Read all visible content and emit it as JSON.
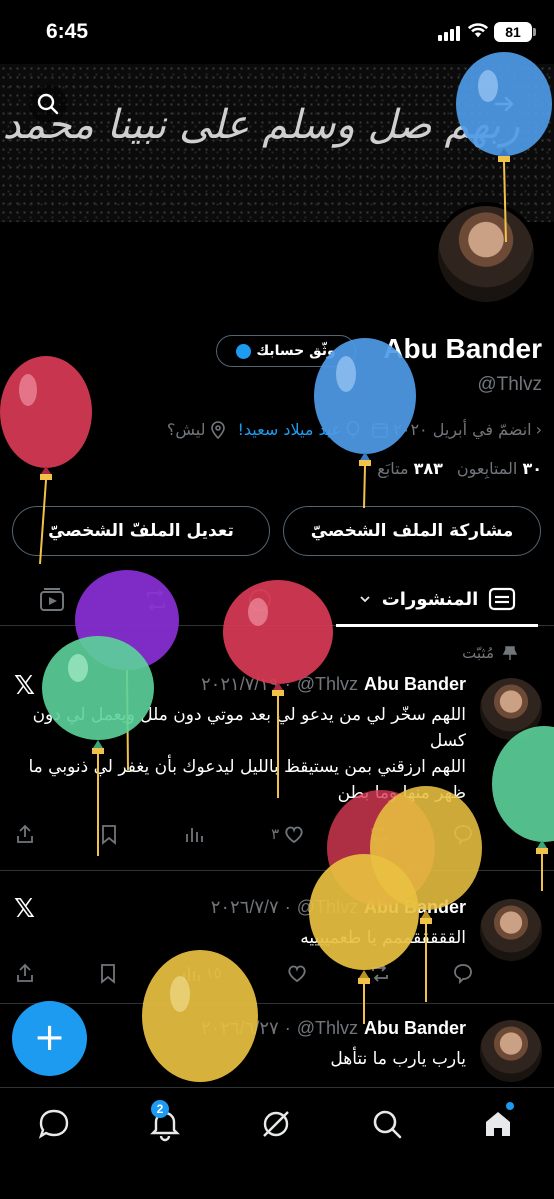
{
  "status_bar": {
    "time": "6:45",
    "battery": "81"
  },
  "banner": {
    "text": "ربهم صل وسلم على نبينا محمد"
  },
  "profile": {
    "verify_label": "وثّق حسابك",
    "display_name": "Abu Bander",
    "handle": "@Thlvz",
    "location": "ليش؟",
    "birthday": "عيد ميلاد سعيد!",
    "joined": "انضمّ في أبريل ٢٠٢٠",
    "following_count": "٣٨٣",
    "following_label": "متابَع",
    "followers_count": "٣٠",
    "followers_label": "المتابِعون",
    "share_label": "مشاركة الملف الشخصيّ",
    "edit_label": "تعديل الملفّ الشخصيّ"
  },
  "tabs": {
    "posts_label": "المنشورات"
  },
  "pinned_label": "مُثبّت",
  "tweets": [
    {
      "name": "Abu Bander",
      "handle": "@Thlvz",
      "date": "٢٠٢١/٧/١٩",
      "body": "اللهم سخّر لي من يدعو لي بعد موتي دون ملل ويعمل لي دون كسل\nاللهم ارزقني بمن يستيقظ بالليل ليدعوك بأن يغفر لي ذنوبي ما ظهر منها وما بطن",
      "likes": "٣",
      "views": ""
    },
    {
      "name": "Abu Bander",
      "handle": "@Thlvz",
      "date": "٢٠٢٦/٧/٧",
      "body": "القققققممم يا طعمييييه",
      "likes": "",
      "views": "١٥"
    },
    {
      "name": "Abu Bander",
      "handle": "@Thlvz",
      "date": "٢٠٢٦/٦/٢٧",
      "body": "يارب يارب ما نتأهل",
      "likes": "",
      "views": ""
    }
  ],
  "nav": {
    "notifications_badge": "2"
  },
  "colors": {
    "accent": "#1d9bf0",
    "background": "#000000",
    "muted": "#71767b",
    "border": "#2f3336"
  },
  "icons": [
    "search-icon",
    "arrow-icon",
    "location-icon",
    "balloon-icon",
    "calendar-icon",
    "posts-tab-icon",
    "chevron-down-icon",
    "repost-icon",
    "spaces-icon",
    "media-icon",
    "pin-icon",
    "x-logo-icon",
    "share-icon",
    "bookmark-icon",
    "views-icon",
    "heart-icon",
    "reply-icon",
    "plus-icon",
    "home-icon",
    "search-nav-icon",
    "grok-icon",
    "bell-icon",
    "messages-icon"
  ]
}
